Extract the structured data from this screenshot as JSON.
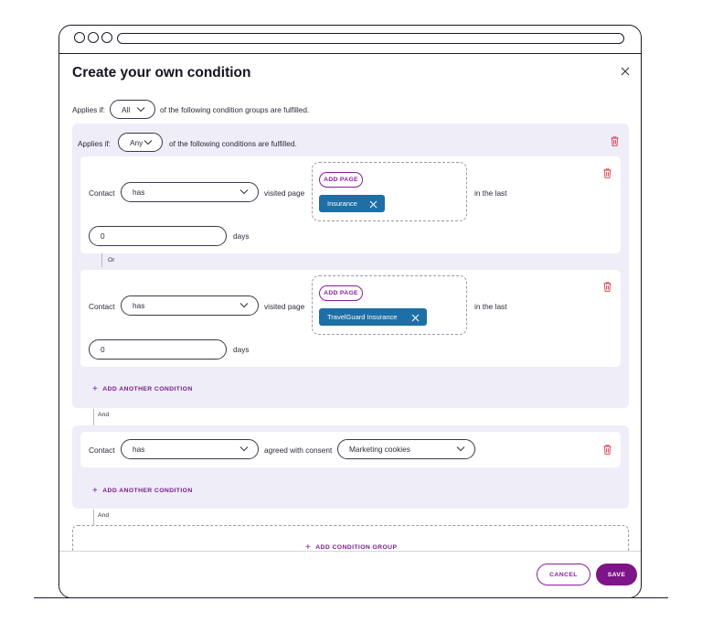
{
  "dialog": {
    "title": "Create your own condition"
  },
  "applies_outer": {
    "prefix": "Applies if:",
    "value": "All",
    "suffix": "of the following condition groups are fulfilled."
  },
  "group1": {
    "applies": {
      "prefix": "Applies if:",
      "value": "Any",
      "suffix": "of the following conditions are fulfilled."
    },
    "conditions": [
      {
        "subject": "Contact",
        "operator": "has",
        "action": "visited page",
        "add_page": "ADD PAGE",
        "chip": "Insurance",
        "period": "in the last",
        "days_value": "0",
        "days_unit": "days"
      },
      {
        "subject": "Contact",
        "operator": "has",
        "action": "visited page",
        "add_page": "ADD PAGE",
        "chip": "TravelGuard Insurance",
        "period": "in the last",
        "days_value": "0",
        "days_unit": "days"
      }
    ],
    "connector": "Or",
    "add_condition": "ADD ANOTHER CONDITION"
  },
  "connector1": "And",
  "group2": {
    "condition": {
      "subject": "Contact",
      "operator": "has",
      "action": "agreed with consent",
      "consent": "Marketing cookies"
    },
    "add_condition": "ADD ANOTHER CONDITION"
  },
  "connector2": "And",
  "add_group": "ADD CONDITION GROUP",
  "footer": {
    "cancel": "CANCEL",
    "save": "SAVE"
  },
  "colors": {
    "accent": "#7d1487",
    "chip": "#1e6fa5",
    "group_bg": "#eeedf8",
    "trash": "#d0394a"
  }
}
